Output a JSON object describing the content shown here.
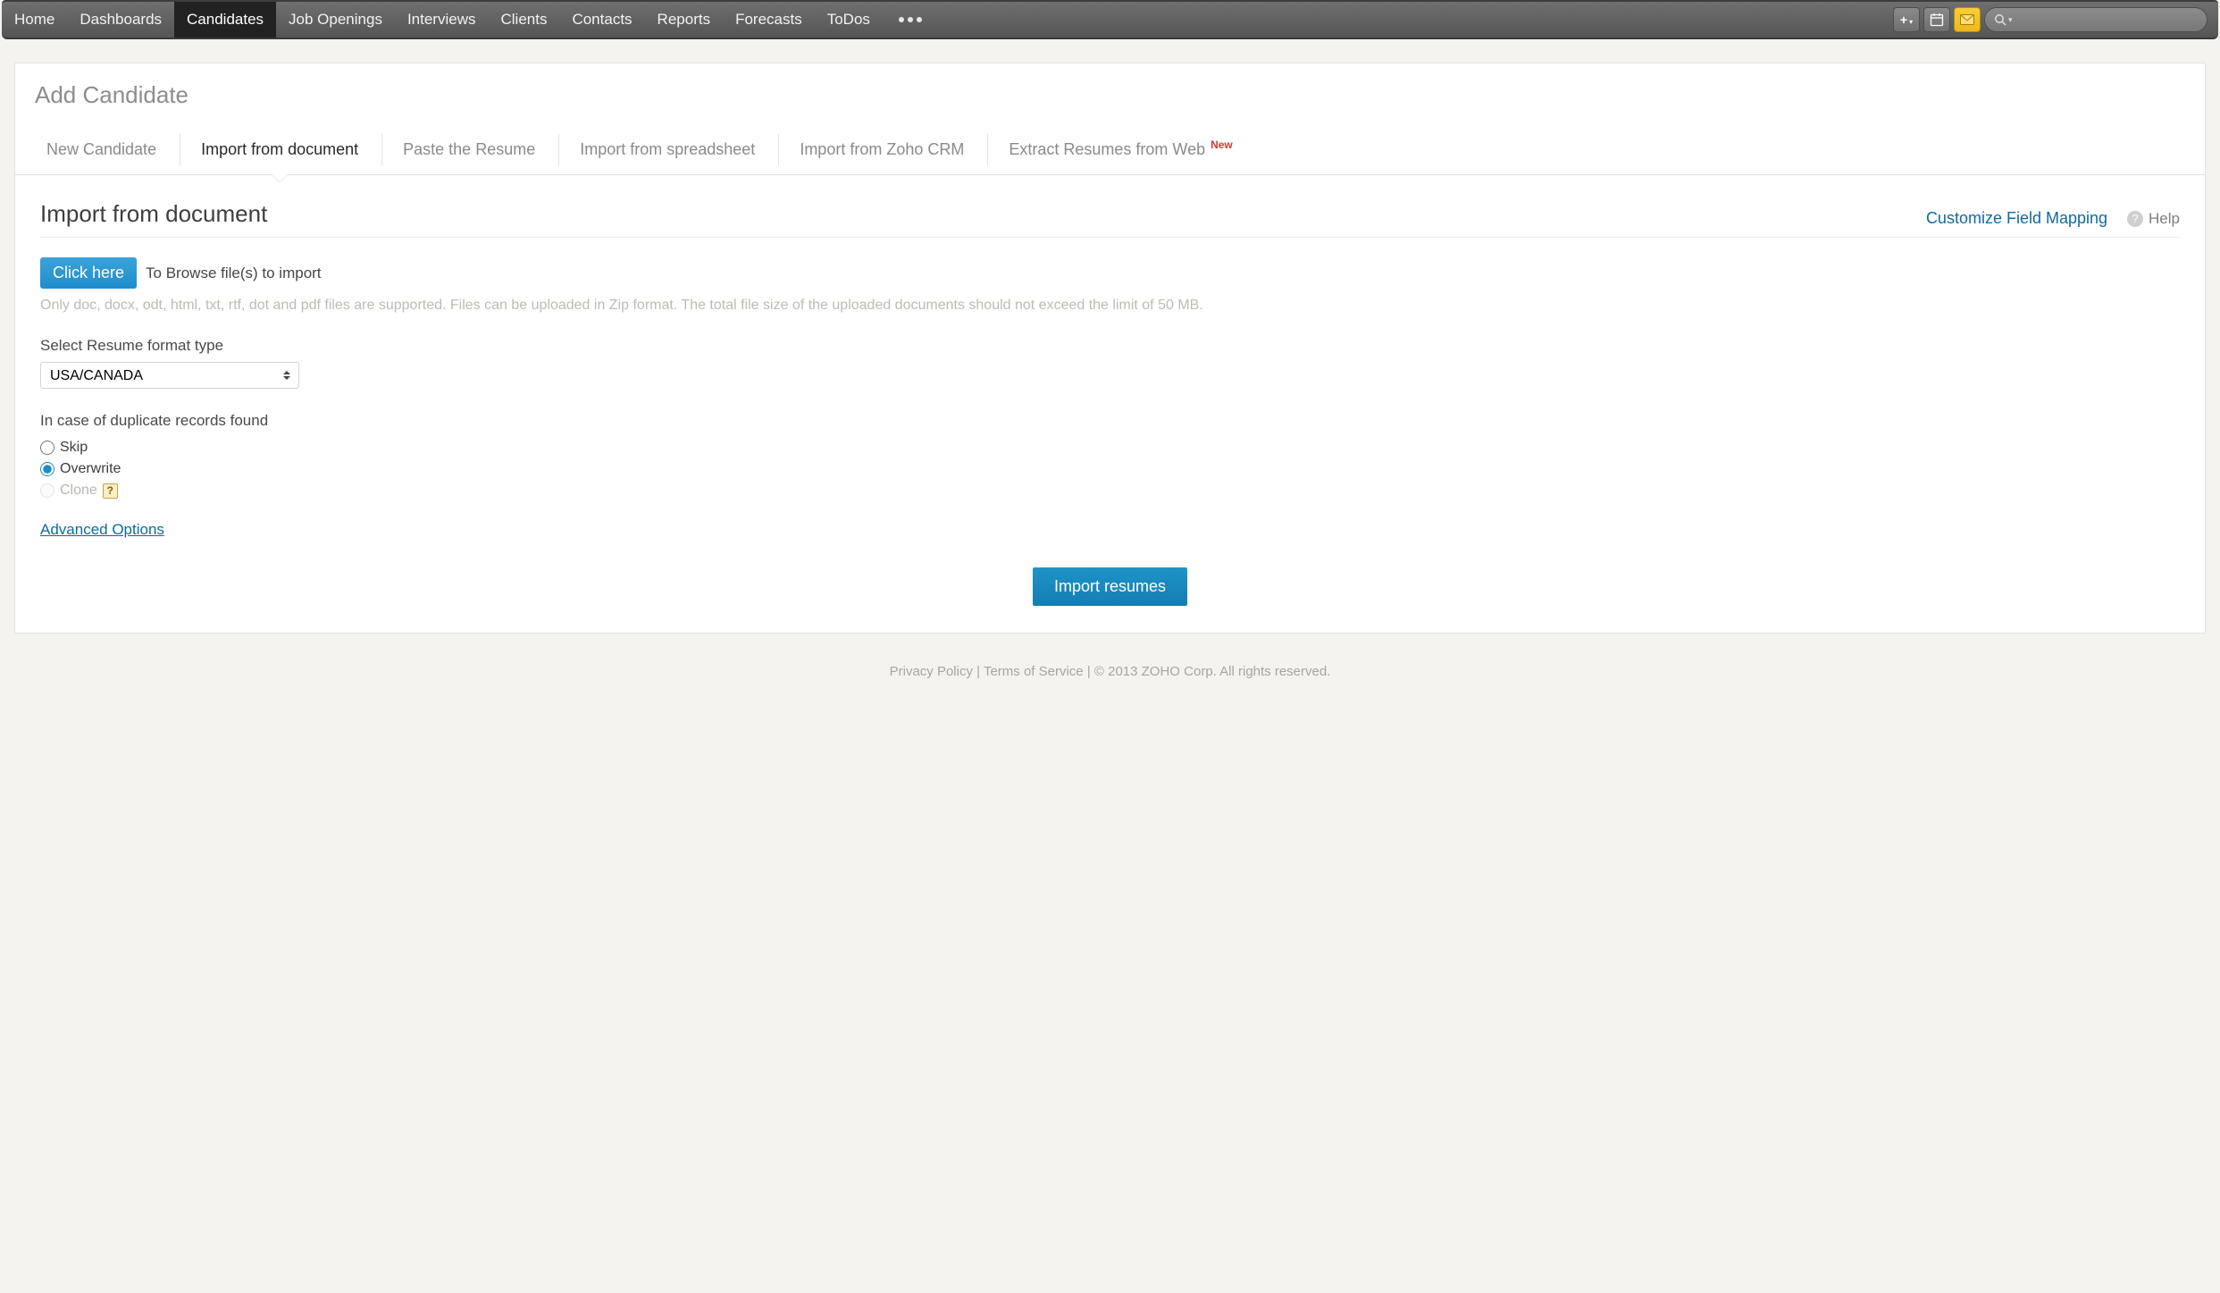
{
  "top_nav": {
    "items": [
      "Home",
      "Dashboards",
      "Candidates",
      "Job Openings",
      "Interviews",
      "Clients",
      "Contacts",
      "Reports",
      "Forecasts",
      "ToDos"
    ],
    "active_index": 2
  },
  "icons": {
    "plus": "plus-add",
    "calendar": "calendar",
    "mail": "mail",
    "search": "search"
  },
  "page": {
    "title": "Add Candidate"
  },
  "subtabs": {
    "items": [
      {
        "label": "New Candidate"
      },
      {
        "label": "Import from document"
      },
      {
        "label": "Paste the Resume"
      },
      {
        "label": "Import from spreadsheet"
      },
      {
        "label": "Import from Zoho CRM"
      },
      {
        "label": "Extract Resumes from Web",
        "badge": "New"
      }
    ],
    "active_index": 1
  },
  "content": {
    "title": "Import from document",
    "mapping_link": "Customize Field Mapping",
    "help_label": "Help",
    "click_here": "Click here",
    "browse_text": "To Browse file(s) to import",
    "hint": "Only doc, docx, odt, html, txt, rtf, dot and pdf files are supported. Files can be uploaded in Zip format. The total file size of the uploaded documents should not exceed the limit of 50 MB.",
    "format_label": "Select Resume format type",
    "format_value": "USA/CANADA",
    "duplicate_label": "In case of duplicate records found",
    "radio_options": [
      {
        "label": "Skip",
        "value": "skip",
        "checked": false,
        "disabled": false,
        "help": false
      },
      {
        "label": "Overwrite",
        "value": "overwrite",
        "checked": true,
        "disabled": false,
        "help": false
      },
      {
        "label": "Clone",
        "value": "clone",
        "checked": false,
        "disabled": true,
        "help": true
      }
    ],
    "advanced": "Advanced Options",
    "import_btn": "Import resumes"
  },
  "footer": {
    "privacy": "Privacy Policy",
    "terms": "Terms of Service",
    "sep": " | ",
    "copyright": "© 2013 ZOHO Corp. All rights reserved."
  }
}
